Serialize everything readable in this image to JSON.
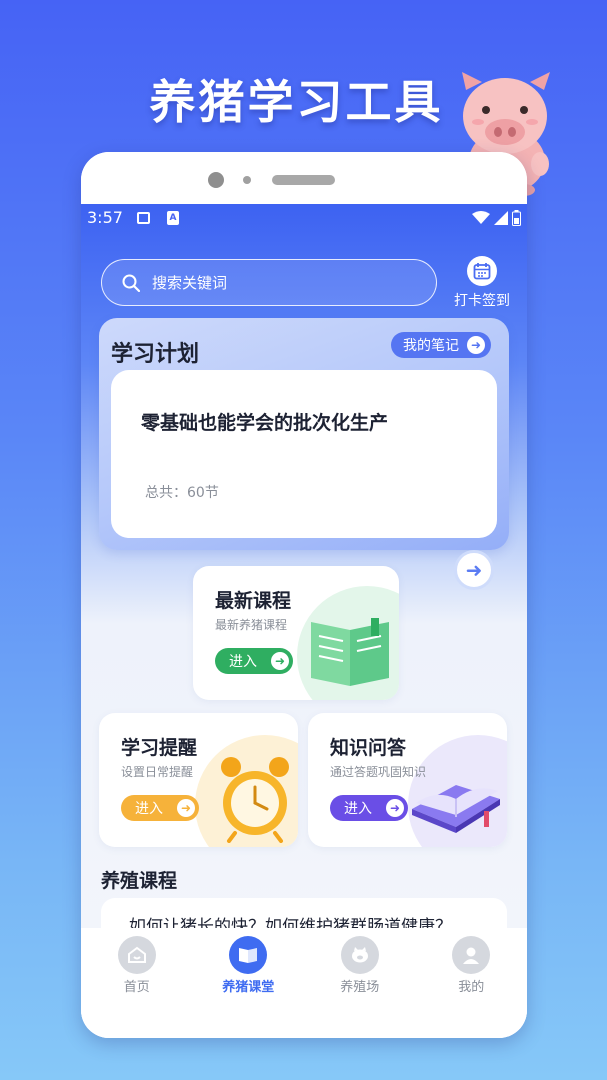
{
  "promo": {
    "title": "养猪学习工具"
  },
  "status_bar": {
    "time": "3:57",
    "a_badge": "A"
  },
  "search": {
    "placeholder": "搜索关键词",
    "icon": "search-icon"
  },
  "checkin": {
    "label": "打卡签到",
    "icon": "calendar-icon"
  },
  "plan": {
    "title": "学习计划",
    "notes_label": "我的笔记",
    "course_title": "零基础也能学会的批次化生产",
    "total": "总共：60节"
  },
  "cards": {
    "latest": {
      "title": "最新课程",
      "subtitle": "最新养猪课程",
      "button": "进入",
      "color": "#2fae61",
      "icon": "book-icon"
    },
    "reminder": {
      "title": "学习提醒",
      "subtitle": "设置日常提醒",
      "button": "进入",
      "color": "#f6b23a",
      "icon": "alarm-clock-icon"
    },
    "qa": {
      "title": "知识问答",
      "subtitle": "通过答题巩固知识",
      "button": "进入",
      "color": "#6a4ee6",
      "icon": "open-book-icon"
    }
  },
  "section": {
    "title": "养殖课程",
    "first_course": "如何让猪长的快？如何维护猪群肠道健康？"
  },
  "tabbar": {
    "items": [
      {
        "label": "首页",
        "icon": "home-icon",
        "active": false
      },
      {
        "label": "养猪课堂",
        "icon": "book-icon",
        "active": true
      },
      {
        "label": "养殖场",
        "icon": "piggy-icon",
        "active": false
      },
      {
        "label": "我的",
        "icon": "user-icon",
        "active": false
      }
    ]
  },
  "colors": {
    "accent": "#3f6cf1",
    "background_top": "#4663f5",
    "background_bottom": "#86c8f8"
  }
}
